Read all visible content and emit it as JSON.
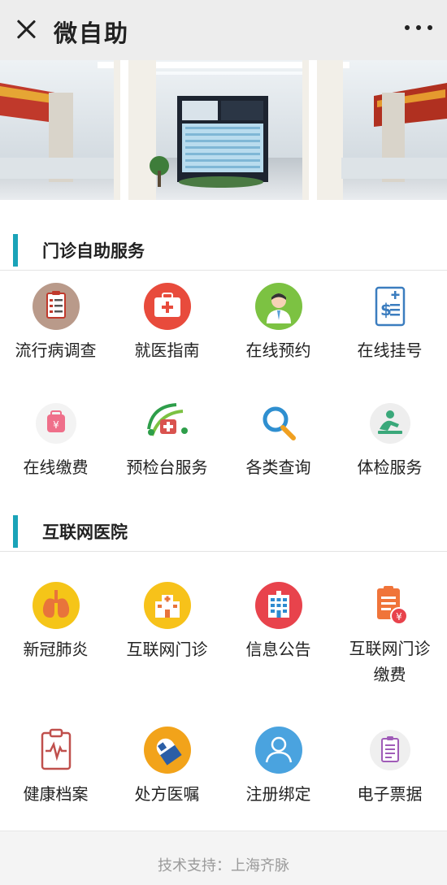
{
  "header": {
    "title": "微自助"
  },
  "sections": [
    {
      "title": "门诊自助服务",
      "items": [
        {
          "label": "流行病调查",
          "icon": "clipboard-checklist-icon"
        },
        {
          "label": "就医指南",
          "icon": "medical-guide-icon"
        },
        {
          "label": "在线预约",
          "icon": "doctor-icon"
        },
        {
          "label": "在线挂号",
          "icon": "bill-dollar-icon"
        },
        {
          "label": "在线缴费",
          "icon": "payment-bag-icon"
        },
        {
          "label": "预检台服务",
          "icon": "medical-kit-icon"
        },
        {
          "label": "各类查询",
          "icon": "magnifier-icon"
        },
        {
          "label": "体检服务",
          "icon": "health-check-icon"
        }
      ]
    },
    {
      "title": "互联网医院",
      "items": [
        {
          "label": "新冠肺炎",
          "icon": "lungs-icon"
        },
        {
          "label": "互联网门诊",
          "icon": "hospital-building-icon"
        },
        {
          "label": "信息公告",
          "icon": "hospital-icon"
        },
        {
          "label": "互联网门诊缴费",
          "label_line1": "互联网门诊",
          "label_line2": "缴费",
          "icon": "document-payment-icon"
        },
        {
          "label": "健康档案",
          "icon": "health-record-icon"
        },
        {
          "label": "处方医嘱",
          "icon": "prescription-icon"
        },
        {
          "label": "注册绑定",
          "icon": "user-icon"
        },
        {
          "label": "电子票据",
          "icon": "e-receipt-icon"
        }
      ]
    }
  ],
  "footer": {
    "text": "技术支持：上海齐脉"
  },
  "colors": {
    "accent": "#1aa3b8",
    "topbar": "#ededed"
  }
}
